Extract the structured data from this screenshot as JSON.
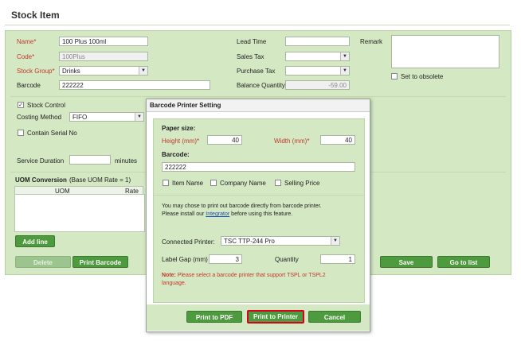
{
  "page": {
    "title": "Stock Item"
  },
  "form": {
    "name_label": "Name*",
    "name_value": "100 Plus 100ml",
    "code_label": "Code*",
    "code_value": "100Plus",
    "stock_group_label": "Stock Group*",
    "stock_group_value": "Drinks",
    "barcode_label": "Barcode",
    "barcode_value": "222222",
    "lead_time_label": "Lead Time",
    "sales_tax_label": "Sales Tax",
    "purchase_tax_label": "Purchase Tax",
    "balance_qty_label": "Balance Quantity",
    "balance_qty_value": "-59.00",
    "remark_label": "Remark",
    "obsolete_label": "Set to obsolete",
    "stock_control_label": "Stock Control",
    "costing_method_label": "Costing Method",
    "costing_method_value": "FIFO",
    "serial_label": "Contain Serial No",
    "service_duration_label": "Service Duration",
    "minutes_label": "minutes"
  },
  "uom": {
    "section_label": "UOM Conversion",
    "base_note": "(Base UOM Rate = 1)",
    "col_uom": "UOM",
    "col_rate": "Rate",
    "add_line": "Add line"
  },
  "footer": {
    "delete": "Delete",
    "print_barcode": "Print Barcode",
    "save": "Save",
    "go_to_list": "Go to list"
  },
  "dialog": {
    "title": "Barcode Printer Setting",
    "paper_size_label": "Paper size:",
    "height_label": "Height (mm)*",
    "height_value": "40",
    "width_label": "Width (mm)*",
    "width_value": "40",
    "barcode_label": "Barcode:",
    "barcode_value": "222222",
    "item_name_label": "Item Name",
    "company_name_label": "Company Name",
    "selling_price_label": "Selling Price",
    "info_line1": "You may chose to print out barcode directly from barcode printer.",
    "info_line2_pre": "Please install our ",
    "info_link": "Integrator",
    "info_line2_post": " before using this feature.",
    "connected_printer_label": "Connected Printer:",
    "connected_printer_value": "TSC TTP-244 Pro",
    "label_gap_label": "Label Gap (mm)",
    "label_gap_value": "3",
    "quantity_label": "Quantity",
    "quantity_value": "1",
    "note_bold": "Note:",
    "note_text": " Please select a barcode printer that support TSPL or TSPL2",
    "note_text2": "language.",
    "print_pdf": "Print to PDF",
    "print_printer": "Print to Printer",
    "cancel": "Cancel"
  },
  "colors": {
    "panel": "#d4e8c4",
    "button": "#4e9a3e",
    "required": "#c0392b",
    "highlight": "#d9001b"
  }
}
